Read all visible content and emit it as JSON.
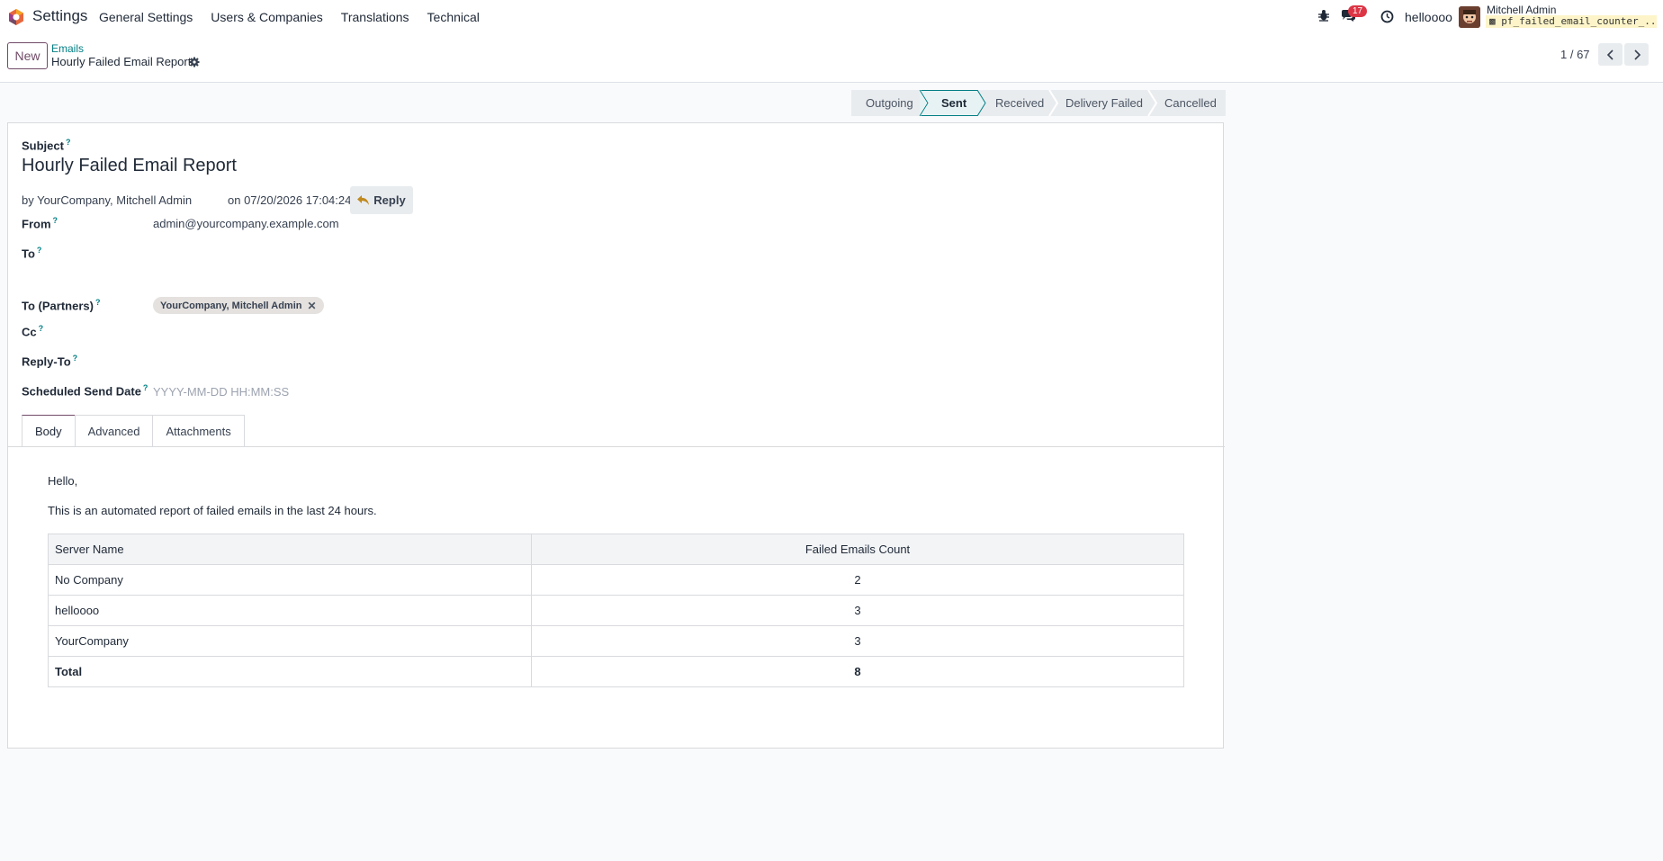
{
  "navbar": {
    "app_title": "Settings",
    "menu": [
      "General Settings",
      "Users & Companies",
      "Translations",
      "Technical"
    ],
    "message_count": "17",
    "company": "helloooo",
    "user_name": "Mitchell Admin",
    "database": "pf_failed_email_counter_..."
  },
  "control_panel": {
    "new_label": "New",
    "breadcrumb_parent": "Emails",
    "breadcrumb_current": "Hourly Failed Email Report",
    "pager": "1 / 67"
  },
  "statusbar": {
    "stages": [
      "Outgoing",
      "Sent",
      "Received",
      "Delivery Failed",
      "Cancelled"
    ],
    "active_stage": "Sent"
  },
  "form": {
    "subject_label": "Subject",
    "subject": "Hourly Failed Email Report",
    "by_line": "by YourCompany, Mitchell Admin",
    "on_line": "on 07/20/2026 17:04:24",
    "reply_label": "Reply",
    "from_label": "From",
    "from_value": "admin@yourcompany.example.com",
    "to_label": "To",
    "to_partners_label": "To (Partners)",
    "to_partners_tag": "YourCompany, Mitchell Admin",
    "cc_label": "Cc",
    "reply_to_label": "Reply-To",
    "scheduled_label": "Scheduled Send Date",
    "scheduled_placeholder": "YYYY-MM-DD HH:MM:SS",
    "help_mark": "?"
  },
  "tabs": [
    "Body",
    "Advanced",
    "Attachments"
  ],
  "body": {
    "greeting": "Hello,",
    "intro": "This is an automated report of failed emails in the last 24 hours.",
    "table": {
      "headers": [
        "Server Name",
        "Failed Emails Count"
      ],
      "rows": [
        [
          "No Company",
          "2"
        ],
        [
          "helloooo",
          "3"
        ],
        [
          "YourCompany",
          "3"
        ]
      ],
      "total": [
        "Total",
        "8"
      ]
    }
  },
  "colors": {
    "brand": "#714b67",
    "accent": "#017e84",
    "badge": "#dc3545"
  }
}
